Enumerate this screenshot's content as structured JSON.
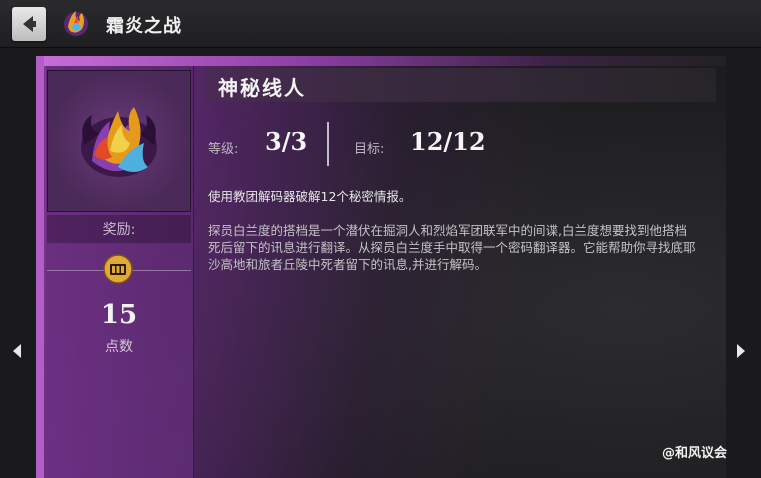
{
  "header": {
    "title": "霜炎之战",
    "back_icon": "back-arrow-icon",
    "title_icon": "flame-emblem-icon"
  },
  "mission": {
    "title": "神秘线人",
    "level_label": "等级:",
    "level_value": "3/3",
    "target_label": "目标:",
    "target_value": "12/12",
    "summary": "使用教团解码器破解12个秘密情报。",
    "description": "探员白兰度的搭档是一个潜伏在掘洞人和烈焰军团联军中的间谍,白兰度想要找到他搭档死后留下的讯息进行翻译。从探员白兰度手中取得一个密码翻译器。它能帮助你寻找底耶沙高地和旅者丘陵中死者留下的讯息,并进行解码。"
  },
  "reward": {
    "label": "奖励:",
    "points": "15",
    "unit": "点数",
    "icon": "achievement-chest-icon"
  },
  "navigation": {
    "prev_icon": "arrow-left-icon",
    "next_icon": "arrow-right-icon"
  },
  "watermark": "@和风议会",
  "colors": {
    "accent_purple": "#a24fb8",
    "panel_dark": "#1e1e20",
    "text_light": "#f4f4f4"
  }
}
